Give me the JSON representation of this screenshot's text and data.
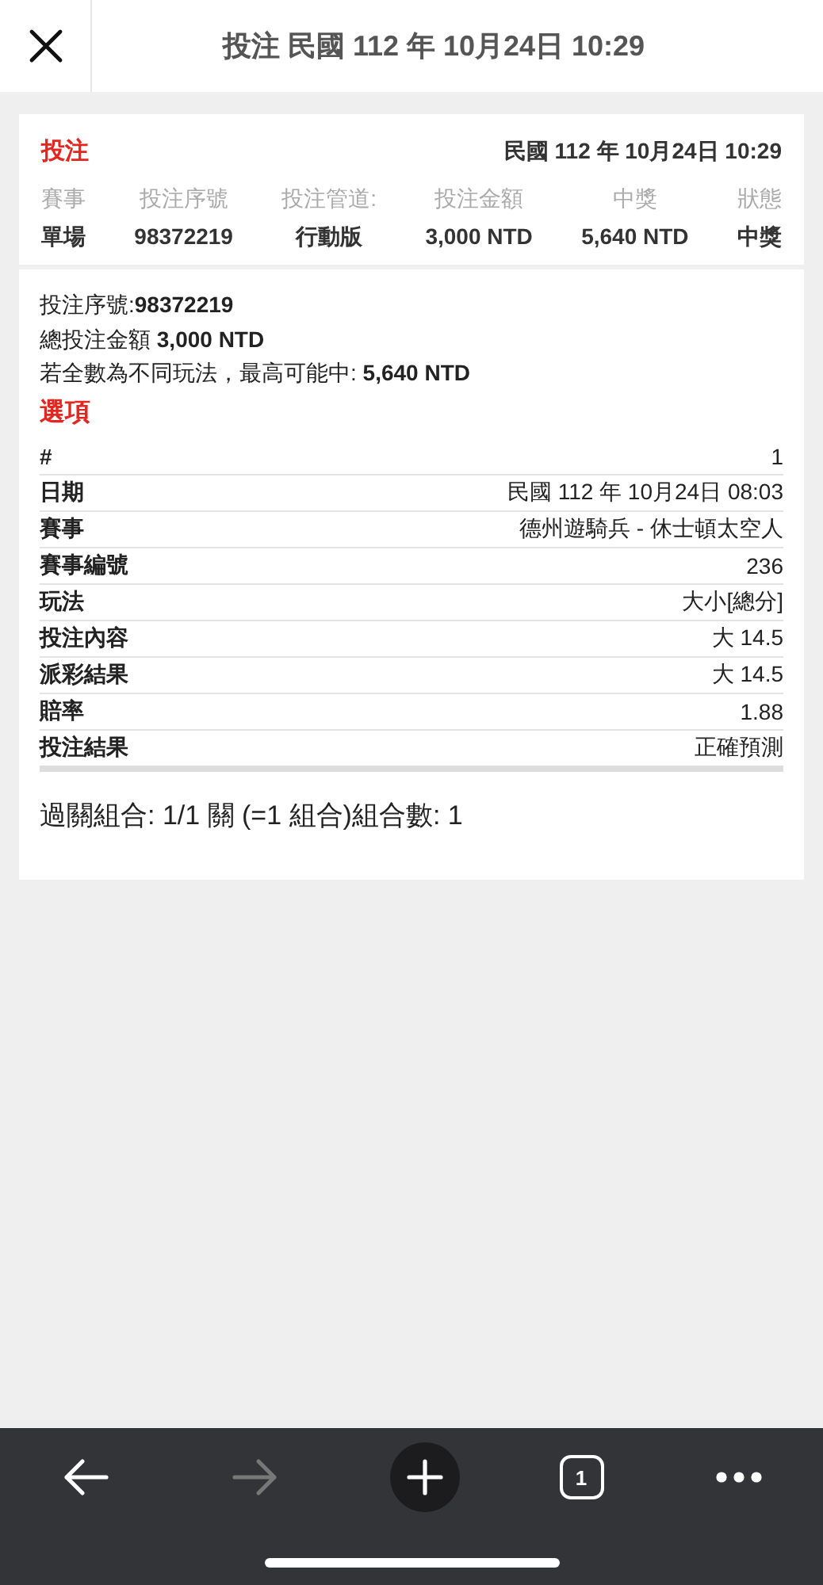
{
  "header": {
    "title": "投注 民國 112 年 10月24日 10:29"
  },
  "summary": {
    "label": "投注",
    "datetime": "民國 112 年 10月24日 10:29",
    "columns": [
      {
        "heading": "賽事",
        "value": "單場"
      },
      {
        "heading": "投注序號",
        "value": "98372219"
      },
      {
        "heading": "投注管道:",
        "value": "行動版"
      },
      {
        "heading": "投注金額",
        "value": "3,000 NTD"
      },
      {
        "heading": "中獎",
        "value": "5,640 NTD"
      },
      {
        "heading": "狀態",
        "value": "中獎"
      }
    ]
  },
  "details": [
    "投注序號:**98372219**",
    "總投注金額 **3,000 NTD**",
    "若全數為不同玩法，最高可能中: **5,640 NTD**"
  ],
  "selection_title": "選項",
  "rows": [
    {
      "label": "#",
      "value": "1"
    },
    {
      "label": "日期",
      "value": "民國 112 年 10月24日 08:03"
    },
    {
      "label": "賽事",
      "value": "德州遊騎兵 - 休士頓太空人"
    },
    {
      "label": "賽事編號",
      "value": "236"
    },
    {
      "label": "玩法",
      "value": "大小[總分]"
    },
    {
      "label": "投注內容",
      "value": "大 14.5"
    },
    {
      "label": "派彩結果",
      "value": "大 14.5"
    },
    {
      "label": "賠率",
      "value": "1.88"
    },
    {
      "label": "投注結果",
      "value": "正確預測"
    }
  ],
  "combination": "過關組合: 1/1 關 (=1 組合)組合數: 1",
  "toolbar": {
    "back_disabled": false,
    "forward_disabled": true,
    "tab_count": "1"
  }
}
